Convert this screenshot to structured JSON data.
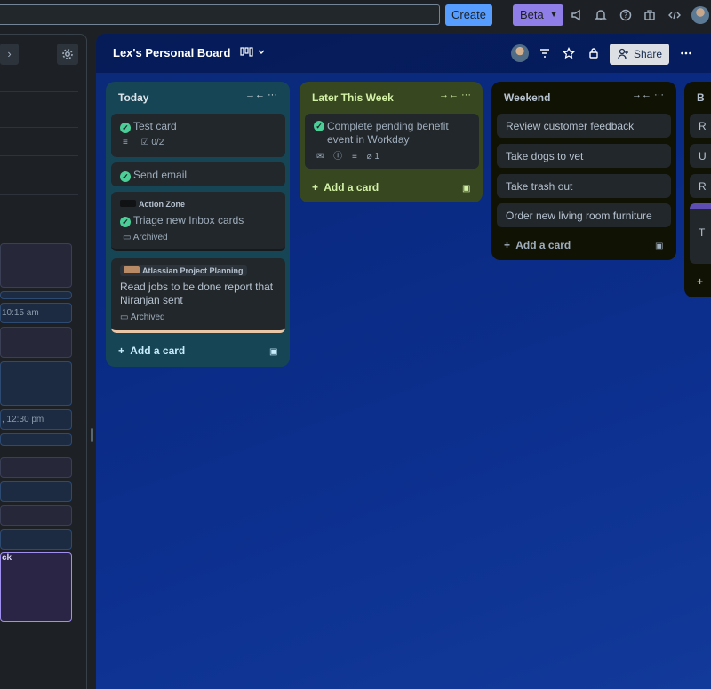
{
  "topbar": {
    "create_label": "Create",
    "beta_label": "Beta",
    "icons": [
      "megaphone-icon",
      "bell-icon",
      "help-icon",
      "briefcase-icon",
      "code-icon"
    ]
  },
  "sidebar": {
    "times": [
      "10:15 am",
      ", 12:30 pm"
    ],
    "selected_fragment": "ck"
  },
  "board": {
    "title": "Lex's Personal Board",
    "share_label": "Share",
    "lists": [
      {
        "title": "Today",
        "cards": [
          {
            "title": "Test card",
            "checklist": "0/2"
          },
          {
            "title": "Send email"
          },
          {
            "chip": "Action Zone",
            "title": "Triage new Inbox cards",
            "status": "Archived"
          },
          {
            "chip": "Atlassian Project Planning",
            "title": "Read jobs to be done report that Niranjan sent",
            "status": "Archived"
          }
        ],
        "add_label": "Add a card"
      },
      {
        "title": "Later This Week",
        "cards": [
          {
            "title": "Complete pending benefit event in Workday",
            "attachments": "1"
          }
        ],
        "add_label": "Add a card"
      },
      {
        "title": "Weekend",
        "cards": [
          {
            "title": "Review customer feedback"
          },
          {
            "title": "Take dogs to vet"
          },
          {
            "title": "Take trash out"
          },
          {
            "title": "Order new living room furniture"
          }
        ],
        "add_label": "Add a card"
      },
      {
        "title": "B",
        "cards": [
          {
            "title": "R"
          },
          {
            "title": "U"
          },
          {
            "title": "R"
          },
          {
            "title": "T"
          }
        ]
      }
    ]
  },
  "colors": {
    "today_list": "#164555",
    "later_list": "#37471f",
    "weekend_list": "#101204",
    "create_button": "#579dff",
    "beta_button": "#8f7ee7"
  }
}
